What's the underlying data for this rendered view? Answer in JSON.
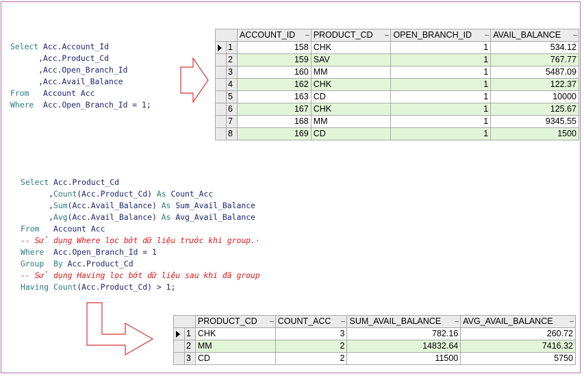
{
  "query1": {
    "lines": [
      [
        {
          "t": "Select",
          "k": "kw"
        },
        {
          "t": " Acc.Account_Id",
          "k": ""
        }
      ],
      [
        {
          "t": "      ,Acc.Product_Cd",
          "k": ""
        }
      ],
      [
        {
          "t": "      ,Acc.Open_Branch_Id",
          "k": ""
        }
      ],
      [
        {
          "t": "      ,Acc.Avail_Balance",
          "k": ""
        }
      ],
      [
        {
          "t": "From",
          "k": "kw"
        },
        {
          "t": "   Account Acc",
          "k": ""
        }
      ],
      [
        {
          "t": "Where",
          "k": "kw"
        },
        {
          "t": "  Acc.Open_Branch_Id = 1;",
          "k": ""
        }
      ]
    ]
  },
  "table1": {
    "columns": [
      "ACCOUNT_ID",
      "PRODUCT_CD",
      "OPEN_BRANCH_ID",
      "AVAIL_BALANCE"
    ],
    "rows": [
      {
        "n": "1",
        "cells": [
          "158",
          "CHK",
          "1",
          "534.12"
        ]
      },
      {
        "n": "2",
        "cells": [
          "159",
          "SAV",
          "1",
          "767.77"
        ]
      },
      {
        "n": "3",
        "cells": [
          "160",
          "MM",
          "1",
          "5487.09"
        ]
      },
      {
        "n": "4",
        "cells": [
          "162",
          "CHK",
          "1",
          "122.37"
        ]
      },
      {
        "n": "5",
        "cells": [
          "163",
          "CD",
          "1",
          "10000"
        ]
      },
      {
        "n": "6",
        "cells": [
          "167",
          "CHK",
          "1",
          "125.67"
        ]
      },
      {
        "n": "7",
        "cells": [
          "168",
          "MM",
          "1",
          "9345.55"
        ]
      },
      {
        "n": "8",
        "cells": [
          "169",
          "CD",
          "1",
          "1500"
        ]
      }
    ]
  },
  "query2": {
    "lines": [
      [
        {
          "t": "Select",
          "k": "kw"
        },
        {
          "t": " Acc.Product_Cd",
          "k": ""
        }
      ],
      [
        {
          "t": "      ,",
          "k": ""
        },
        {
          "t": "Count",
          "k": "kw"
        },
        {
          "t": "(Acc.Product_Cd) ",
          "k": ""
        },
        {
          "t": "As",
          "k": "kw"
        },
        {
          "t": " Count_Acc",
          "k": ""
        }
      ],
      [
        {
          "t": "      ,",
          "k": ""
        },
        {
          "t": "Sum",
          "k": "kw"
        },
        {
          "t": "(Acc.Avail_Balance) ",
          "k": ""
        },
        {
          "t": "As",
          "k": "kw"
        },
        {
          "t": " Sum_Avail_Balance",
          "k": ""
        }
      ],
      [
        {
          "t": "      ,",
          "k": ""
        },
        {
          "t": "Avg",
          "k": "kw"
        },
        {
          "t": "(Acc.Avail_Balance) ",
          "k": ""
        },
        {
          "t": "As",
          "k": "kw"
        },
        {
          "t": " Avg_Avail_Balance",
          "k": ""
        }
      ],
      [
        {
          "t": "From",
          "k": "kw"
        },
        {
          "t": "   Account Acc",
          "k": ""
        }
      ],
      [
        {
          "t": "-- Sử dụng Where lọc bớt dữ liệu trước khi group.·",
          "k": "cm"
        }
      ],
      [
        {
          "t": "Where",
          "k": "kw"
        },
        {
          "t": "  Acc.Open_Branch_Id = 1",
          "k": ""
        }
      ],
      [
        {
          "t": "Group",
          "k": "kw"
        },
        {
          "t": "  ",
          "k": ""
        },
        {
          "t": "By",
          "k": "kw"
        },
        {
          "t": " Acc.Product_Cd",
          "k": ""
        }
      ],
      [
        {
          "t": "-- Sử dụng Having lọc bớt dữ liệu sau khi đã group",
          "k": "cm"
        }
      ],
      [
        {
          "t": "Having",
          "k": "kw"
        },
        {
          "t": " ",
          "k": ""
        },
        {
          "t": "Count",
          "k": "kw"
        },
        {
          "t": "(Acc.Product_Cd) > 1;",
          "k": ""
        }
      ]
    ]
  },
  "table2": {
    "columns": [
      "PRODUCT_CD",
      "COUNT_ACC",
      "SUM_AVAIL_BALANCE",
      "AVG_AVAIL_BALANCE"
    ],
    "rows": [
      {
        "n": "1",
        "cells": [
          "CHK",
          "3",
          "782.16",
          "260.72"
        ]
      },
      {
        "n": "2",
        "cells": [
          "MM",
          "2",
          "14832.64",
          "7416.32"
        ]
      },
      {
        "n": "3",
        "cells": [
          "CD",
          "2",
          "11500",
          "5750"
        ]
      }
    ]
  },
  "colors": {
    "keyword": "#2a7a80",
    "identifier": "#1b2470",
    "comment": "#e01818",
    "arrow": "#d83030",
    "alt_row": "#e2f5d8",
    "frame": "#b070b0"
  },
  "icons": [
    "current-row-indicator-icon",
    "arrow-right-icon",
    "arrow-bent-right-icon"
  ]
}
